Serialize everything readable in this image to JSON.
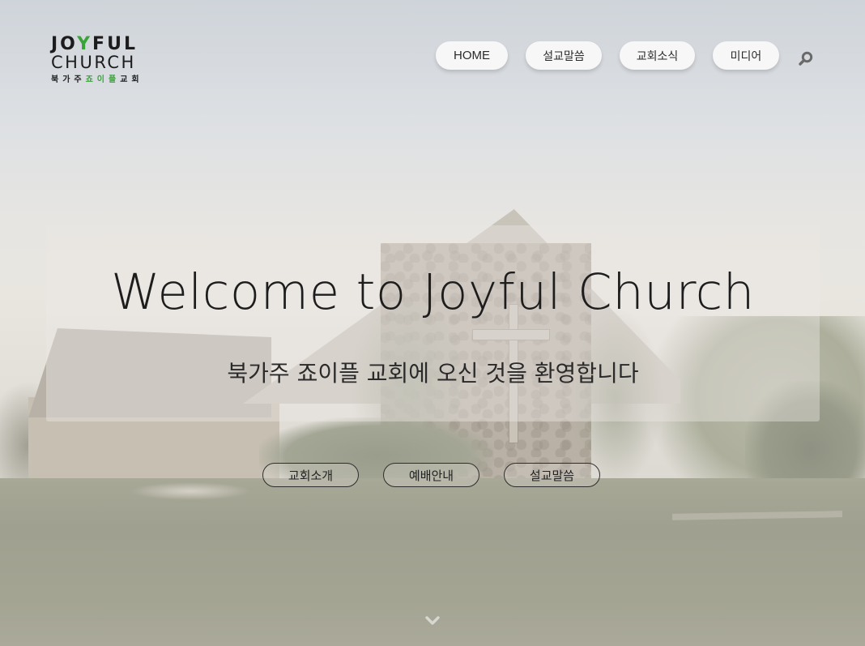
{
  "logo": {
    "line1_start": "JO",
    "line1_y": "Y",
    "line1_end": "FUL",
    "line2": "CHURCH",
    "sub_start": "북가주",
    "sub_green": "죠이플",
    "sub_end": "교회"
  },
  "nav": {
    "items": [
      {
        "label": "HOME"
      },
      {
        "label": "설교말씀"
      },
      {
        "label": "교회소식"
      },
      {
        "label": "미디어"
      }
    ]
  },
  "icons": {
    "search": "search-icon",
    "scroll": "chevron-down-icon"
  },
  "hero": {
    "title": "Welcome to Joyful Church",
    "subtitle": "북가주 죠이플 교회에 오신 것을 환영합니다"
  },
  "cta": {
    "items": [
      {
        "label": "교회소개"
      },
      {
        "label": "예배안내"
      },
      {
        "label": "설교말씀"
      }
    ]
  },
  "colors": {
    "logo_accent": "#3aa33a",
    "nav_bg": "#f7f7f7",
    "text_dark": "#1d1d1d"
  }
}
